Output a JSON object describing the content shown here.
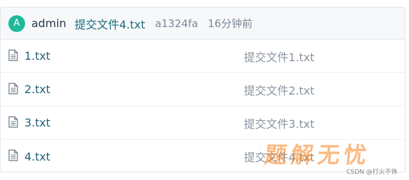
{
  "commit": {
    "avatar_letter": "A",
    "author": "admin",
    "message": "提交文件4.txt",
    "sha": "a1324fa",
    "time": "16分钟前"
  },
  "files": [
    {
      "name": "1.txt",
      "message": "提交文件1.txt",
      "icon": "file-text-icon"
    },
    {
      "name": "2.txt",
      "message": "提交文件2.txt",
      "icon": "file-text-icon"
    },
    {
      "name": "3.txt",
      "message": "提交文件3.txt",
      "icon": "file-text-icon"
    },
    {
      "name": "4.txt",
      "message": "提交文件4.txt",
      "icon": "file-text-icon"
    }
  ],
  "watermark": {
    "logo_text": "题解无忧",
    "credit": "CSDN @打火不休"
  },
  "colors": {
    "avatar": "#20b99a",
    "link": "#20627a",
    "muted": "#8a949e",
    "header_bg": "#f6f8fa"
  }
}
